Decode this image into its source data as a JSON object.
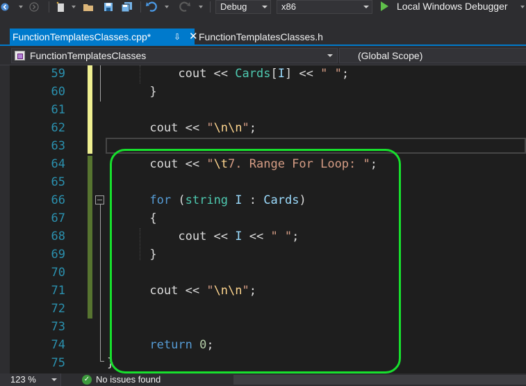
{
  "toolbar": {
    "icons": [
      "back-arrow-icon",
      "forward-arrow-icon",
      "new-project-icon",
      "open-folder-icon",
      "save-icon",
      "save-all-icon",
      "undo-icon",
      "redo-icon",
      "start-debugging-icon"
    ],
    "configuration": "Debug",
    "platform": "x86",
    "run_target": "Local Windows Debugger"
  },
  "tabs": [
    {
      "label": "FunctionTemplatesClasses.cpp*",
      "active": true
    },
    {
      "label": "FunctionTemplatesClasses.h",
      "active": false
    }
  ],
  "navigation": {
    "project": "FunctionTemplatesClasses",
    "scope": "(Global Scope)"
  },
  "editor": {
    "line_numbers": [
      "59",
      "60",
      "61",
      "62",
      "63",
      "64",
      "65",
      "66",
      "67",
      "68",
      "69",
      "70",
      "71",
      "72",
      "73",
      "74",
      "75"
    ],
    "lines": {
      "l59": {
        "a": "cout << ",
        "b": "Cards",
        "c": "[",
        "d": "I",
        "e": "] << ",
        "f": "\" \"",
        "g": ";"
      },
      "l60": {
        "a": "}"
      },
      "l62": {
        "a": "cout << ",
        "b": "\"",
        "c": "\\n\\n",
        "d": "\"",
        "e": ";"
      },
      "l64": {
        "a": "cout << ",
        "b": "\"",
        "c": "\\t",
        "d": "7. Range For Loop: \"",
        "e": ";"
      },
      "l66": {
        "a": "for",
        "b": " (",
        "c": "string",
        "d": " ",
        "e": "I",
        "f": " : ",
        "g": "Cards",
        "h": ")"
      },
      "l67": {
        "a": "{"
      },
      "l68": {
        "a": "cout << ",
        "b": "I",
        "c": " << ",
        "d": "\" \"",
        "e": ";"
      },
      "l69": {
        "a": "}"
      },
      "l71": {
        "a": "cout << ",
        "b": "\"",
        "c": "\\n\\n",
        "d": "\"",
        "e": ";"
      },
      "l74": {
        "a": "return",
        "b": " ",
        "c": "0",
        "d": ";"
      },
      "l75": {
        "a": "}"
      }
    }
  },
  "status": {
    "zoom": "123 %",
    "message": "No issues found"
  },
  "colors": {
    "accent": "#007acc",
    "highlight_box": "#17e02d",
    "unsaved_change": "#efef91",
    "saved_change": "#577430"
  }
}
